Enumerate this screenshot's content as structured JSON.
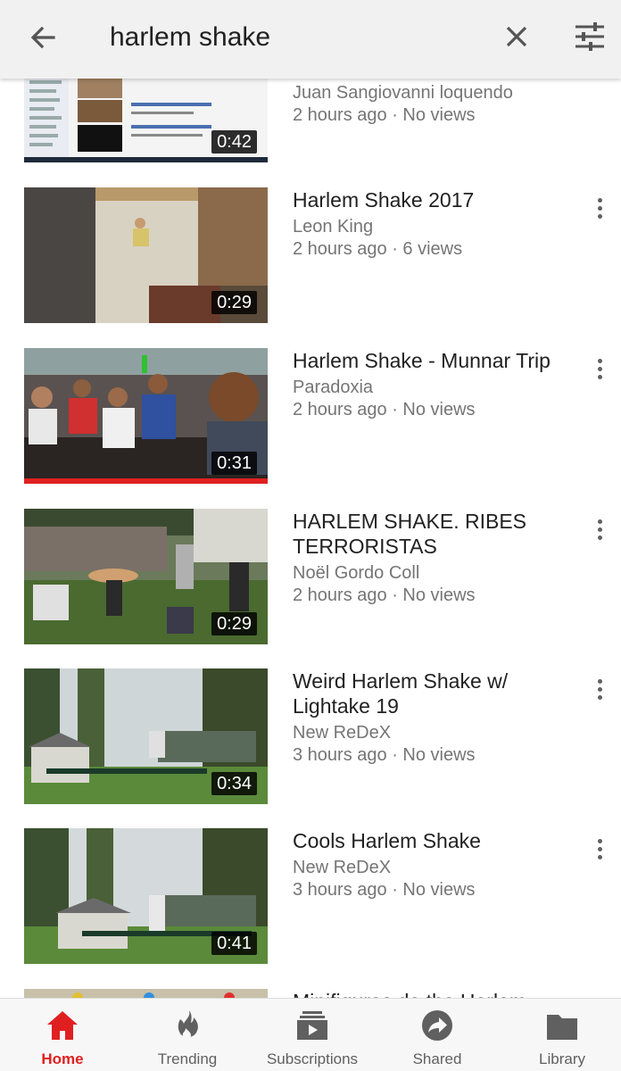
{
  "search": {
    "query": "harlem shake",
    "back_icon": "arrow-back-icon",
    "clear_icon": "close-icon",
    "filter_icon": "filter-sliders-icon"
  },
  "results": [
    {
      "title": "",
      "channel": "Juan Sangiovanni loquendo",
      "stats": "2 hours ago · No views",
      "duration": "0:42",
      "watched": false
    },
    {
      "title": "Harlem Shake 2017",
      "channel": "Leon King",
      "stats": "2 hours ago · 6 views",
      "duration": "0:29",
      "watched": false
    },
    {
      "title": "Harlem Shake - Munnar Trip",
      "channel": "Paradoxia",
      "stats": "2 hours ago · No views",
      "duration": "0:31",
      "watched": true
    },
    {
      "title": "HARLEM SHAKE. RIBES TERRORISTAS",
      "channel": "Noël Gordo Coll",
      "stats": "2 hours ago · No views",
      "duration": "0:29",
      "watched": false
    },
    {
      "title": "Weird Harlem Shake w/ Lightake 19",
      "channel": "New ReDeX",
      "stats": "3 hours ago · No views",
      "duration": "0:34",
      "watched": false
    },
    {
      "title": "Cools Harlem Shake",
      "channel": "New ReDeX",
      "stats": "3 hours ago · No views",
      "duration": "0:41",
      "watched": false
    },
    {
      "title": "Minifigures do the Harlem",
      "channel": "",
      "stats": "",
      "duration": "",
      "watched": false
    }
  ],
  "nav": {
    "items": [
      {
        "label": "Home",
        "icon": "home-icon",
        "active": true
      },
      {
        "label": "Trending",
        "icon": "flame-icon",
        "active": false
      },
      {
        "label": "Subscriptions",
        "icon": "subscriptions-icon",
        "active": false
      },
      {
        "label": "Shared",
        "icon": "share-arrow-icon",
        "active": false
      },
      {
        "label": "Library",
        "icon": "folder-icon",
        "active": false
      }
    ]
  },
  "colors": {
    "accent": "#e02020",
    "topbar": "#f1f1f1",
    "secondary_text": "#757575"
  }
}
